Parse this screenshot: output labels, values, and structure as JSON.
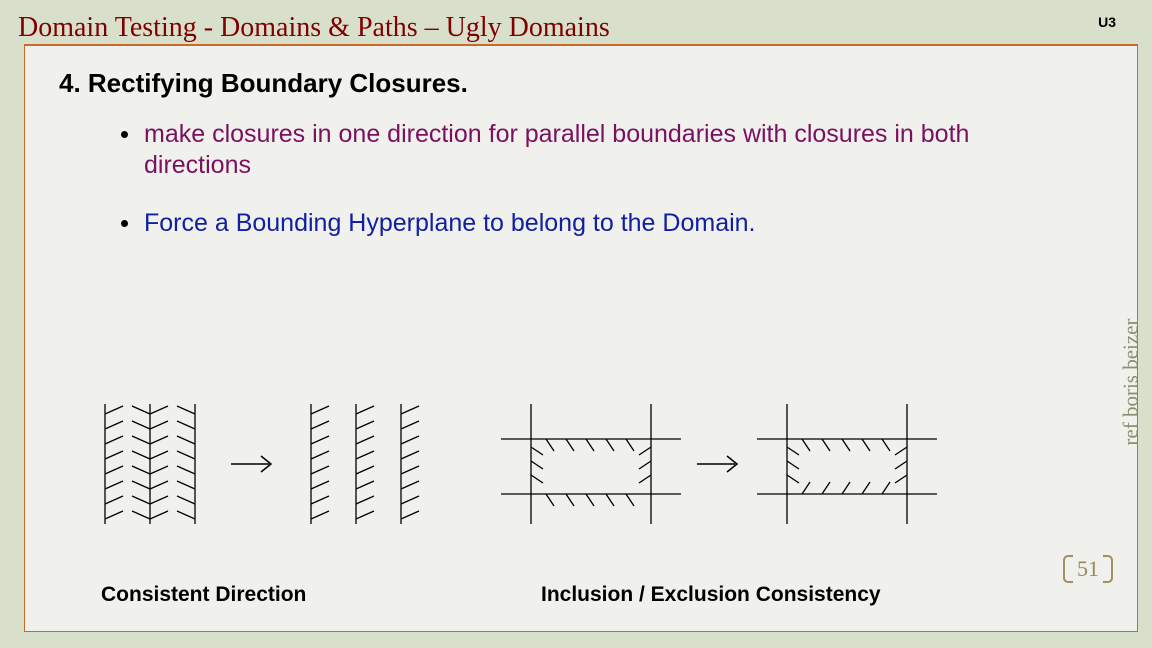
{
  "header": {
    "title": "Domain Testing  -  Domains & Paths – Ugly Domains",
    "unit": "U3"
  },
  "section": {
    "heading": "4. Rectifying Boundary Closures."
  },
  "bullets": {
    "b1": "make closures in one direction for parallel boundaries with closures in both directions",
    "b2": "Force a Bounding Hyperplane to belong to the Domain."
  },
  "captions": {
    "c1": "Consistent Direction",
    "c2": "Inclusion / Exclusion Consistency"
  },
  "side_ref": "ref boris beizer",
  "page_number": "51"
}
